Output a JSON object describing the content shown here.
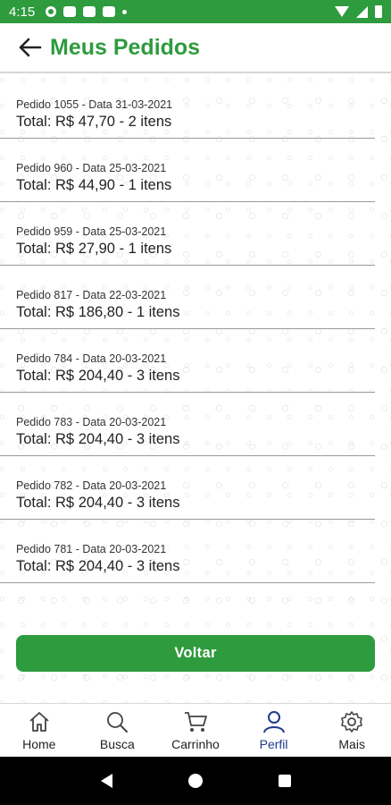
{
  "status_bar": {
    "time": "4:15"
  },
  "header": {
    "title": "Meus Pedidos"
  },
  "orders": [
    {
      "meta": "Pedido 1055 - Data 31-03-2021",
      "total": "Total: R$ 47,70 - 2 itens"
    },
    {
      "meta": "Pedido 960 - Data 25-03-2021",
      "total": "Total: R$ 44,90 - 1 itens"
    },
    {
      "meta": "Pedido 959 - Data 25-03-2021",
      "total": "Total: R$ 27,90 - 1 itens"
    },
    {
      "meta": "Pedido 817 - Data 22-03-2021",
      "total": "Total: R$ 186,80 - 1 itens"
    },
    {
      "meta": "Pedido 784 - Data 20-03-2021",
      "total": "Total: R$ 204,40 - 3 itens"
    },
    {
      "meta": "Pedido 783 - Data 20-03-2021",
      "total": "Total: R$ 204,40 - 3 itens"
    },
    {
      "meta": "Pedido 782 - Data 20-03-2021",
      "total": "Total: R$ 204,40 - 3 itens"
    },
    {
      "meta": "Pedido 781 - Data 20-03-2021",
      "total": "Total: R$ 204,40 - 3 itens"
    }
  ],
  "actions": {
    "voltar_label": "Voltar"
  },
  "bottom_nav": {
    "items": [
      {
        "label": "Home",
        "icon": "home-icon"
      },
      {
        "label": "Busca",
        "icon": "search-icon"
      },
      {
        "label": "Carrinho",
        "icon": "cart-icon"
      },
      {
        "label": "Perfil",
        "icon": "user-icon",
        "active": true
      },
      {
        "label": "Mais",
        "icon": "gear-icon"
      }
    ]
  },
  "theme": {
    "primary": "#2e9b3e",
    "active_nav": "#1f3a8a"
  }
}
